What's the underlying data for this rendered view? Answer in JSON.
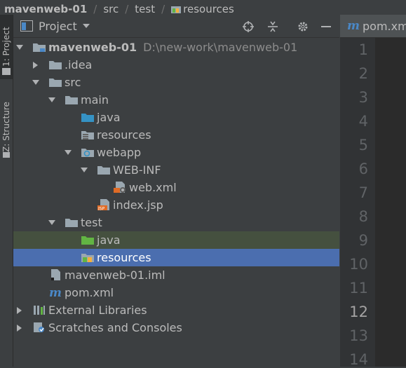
{
  "breadcrumb": [
    "mavenweb-01",
    "src",
    "test",
    "resources"
  ],
  "left_stripe": {
    "project_tab": "1: Project",
    "structure_tab": "Z: Structure"
  },
  "panel": {
    "title": "Project",
    "icons": [
      "target-icon",
      "collapse-icon",
      "gear-icon",
      "minimize-icon"
    ]
  },
  "tree": [
    {
      "label": "mavenweb-01",
      "hint": "D:\\new-work\\mavenweb-01",
      "bold": true,
      "depth": 0,
      "arrow": "down",
      "icon": "module-folder"
    },
    {
      "label": ".idea",
      "depth": 1,
      "arrow": "right",
      "icon": "folder"
    },
    {
      "label": "src",
      "depth": 1,
      "arrow": "down",
      "icon": "folder"
    },
    {
      "label": "main",
      "depth": 2,
      "arrow": "down",
      "icon": "folder"
    },
    {
      "label": "java",
      "depth": 3,
      "arrow": "none",
      "icon": "source-folder"
    },
    {
      "label": "resources",
      "depth": 3,
      "arrow": "none",
      "icon": "resources-folder"
    },
    {
      "label": "webapp",
      "depth": 3,
      "arrow": "down",
      "icon": "web-folder"
    },
    {
      "label": "WEB-INF",
      "depth": 4,
      "arrow": "down",
      "icon": "folder"
    },
    {
      "label": "web.xml",
      "depth": 5,
      "arrow": "none",
      "icon": "xml-file"
    },
    {
      "label": "index.jsp",
      "depth": 4,
      "arrow": "none",
      "icon": "jsp-file"
    },
    {
      "label": "test",
      "depth": 2,
      "arrow": "down",
      "icon": "folder"
    },
    {
      "label": "java",
      "depth": 3,
      "arrow": "none",
      "icon": "test-folder",
      "state": "inactive"
    },
    {
      "label": "resources",
      "depth": 3,
      "arrow": "none",
      "icon": "test-resources-folder",
      "state": "selected"
    },
    {
      "label": "mavenweb-01.iml",
      "depth": 1,
      "arrow": "none",
      "icon": "iml-file"
    },
    {
      "label": "pom.xml",
      "depth": 1,
      "arrow": "none",
      "icon": "maven-file"
    },
    {
      "label": "External Libraries",
      "depth": 0,
      "arrow": "right",
      "icon": "library"
    },
    {
      "label": "Scratches and Consoles",
      "depth": 0,
      "arrow": "right",
      "icon": "scratches"
    }
  ],
  "editor": {
    "tab_label": "pom.xm",
    "line_numbers": [
      "1",
      "2",
      "3",
      "4",
      "5",
      "6",
      "7",
      "8",
      "9",
      "10",
      "11",
      "12",
      "13",
      "14"
    ],
    "current_line": "12"
  }
}
